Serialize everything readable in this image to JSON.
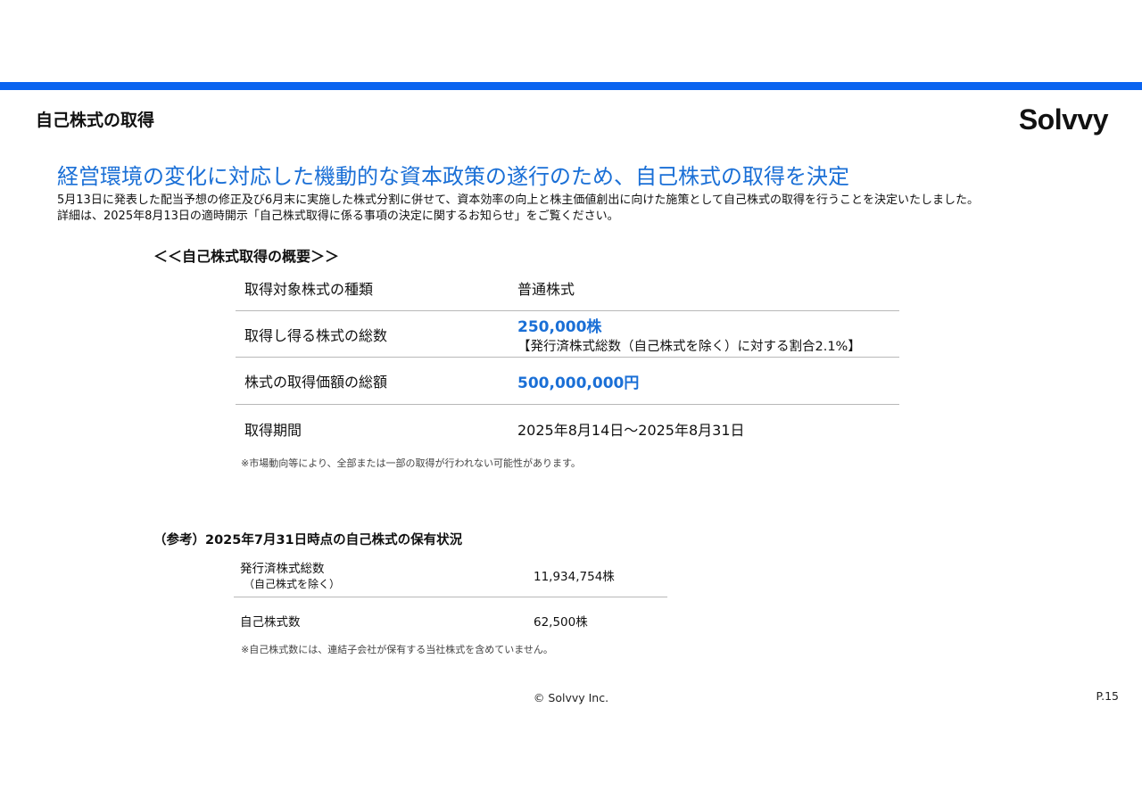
{
  "header": {
    "section_title": "自己株式の取得",
    "logo_text": "Solvvy",
    "accent_color": "#0a64f0"
  },
  "headline": "経営環境の変化に対応した機動的な資本政策の遂行のため、自己株式の取得を決定",
  "description": {
    "line1": "5月13日に発表した配当予想の修正及び6月末に実施した株式分割に併せて、資本効率の向上と株主価値創出に向けた施策として自己株式の取得を行うことを決定いたしました。",
    "line2": "詳細は、2025年8月13日の適時開示「自己株式取得に係る事項の決定に関するお知らせ」をご覧ください。"
  },
  "overview": {
    "title": "＜＜自己株式取得の概要＞＞",
    "rows": [
      {
        "label": "取得対象株式の種類",
        "value": "普通株式"
      },
      {
        "label": "取得し得る株式の総数",
        "value": "250,000株",
        "sub": "【発行済株式総数（自己株式を除く）に対する割合2.1%】"
      },
      {
        "label": "株式の取得価額の総額",
        "value": "500,000,000円"
      },
      {
        "label": "取得期間",
        "value": "2025年8月14日～2025年8月31日"
      }
    ],
    "note": "※市場動向等により、全部または一部の取得が行われない可能性があります。"
  },
  "reference": {
    "title": "（参考）2025年7月31日時点の自己株式の保有状況",
    "rows": [
      {
        "label": "発行済株式総数",
        "sub": "（自己株式を除く）",
        "value": "11,934,754株"
      },
      {
        "label": "自己株式数",
        "value": "62,500株"
      }
    ],
    "note": "※自己株式数には、連結子会社が保有する当社株式を含めていません。"
  },
  "footer": {
    "copyright": "© Solvvy Inc.",
    "page": "P.15"
  }
}
